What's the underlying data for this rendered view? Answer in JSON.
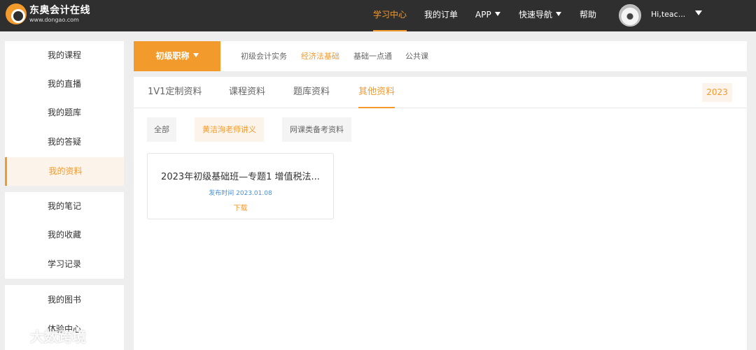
{
  "header": {
    "logo_name": "东奥会计在线",
    "logo_url": "www.dongao.com",
    "nav": [
      {
        "label": "学习中心",
        "active": true
      },
      {
        "label": "我的订单"
      },
      {
        "label": "APP"
      },
      {
        "label": "快速导航"
      },
      {
        "label": "帮助"
      }
    ],
    "username": "Hi,teac..."
  },
  "sidebar": {
    "group1": [
      "我的课程",
      "我的直播",
      "我的题库",
      "我的答疑",
      "我的资料"
    ],
    "group2": [
      "我的笔记",
      "我的收藏",
      "学习记录"
    ],
    "group3": [
      "我的图书",
      "体验中心"
    ],
    "active": "我的资料"
  },
  "category": {
    "dropdown": "初级职称",
    "items": [
      "初级会计实务",
      "经济法基础",
      "基础一点通",
      "公共课"
    ],
    "active": "经济法基础"
  },
  "tabs": [
    "1V1定制资料",
    "课程资料",
    "题库资料",
    "其他资料"
  ],
  "active_tab": "其他资料",
  "year": "2023",
  "filters": [
    "全部",
    "黄洁洵老师讲义",
    "网课类备考资料"
  ],
  "active_filter": "黄洁洵老师讲义",
  "card": {
    "title": "2023年初级基础班—专题1 增值税法...",
    "date": "发布时间 2023.01.08",
    "download": "下载"
  },
  "watermark": "大数跨境",
  "colors": {
    "accent": "#f39a2d",
    "topbar": "#2f2f2f",
    "date": "#4a90d9"
  }
}
